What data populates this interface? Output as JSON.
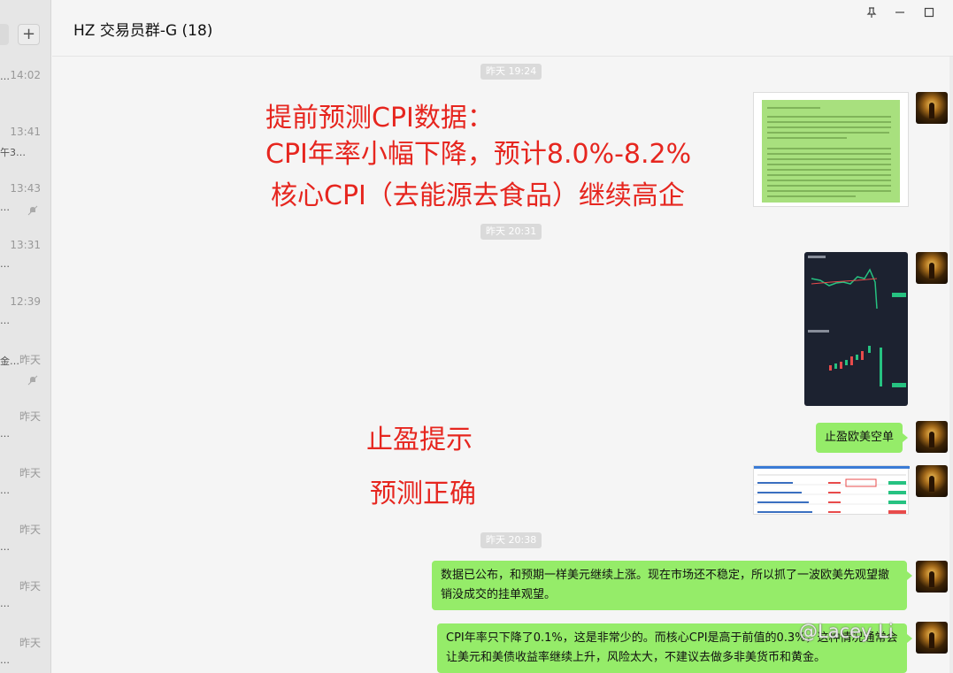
{
  "chat_list": {
    "plus_label": "+",
    "items": [
      {
        "time": "14:02",
        "snippet": "…"
      },
      {
        "time": "13:41",
        "snippet": "午3…"
      },
      {
        "time": "13:43",
        "snippet": "…"
      },
      {
        "time": "13:31",
        "snippet": "…"
      },
      {
        "time": "12:39",
        "snippet": "…"
      },
      {
        "time": "昨天",
        "snippet": "金…"
      },
      {
        "time": "昨天",
        "snippet": "…"
      },
      {
        "time": "昨天",
        "snippet": "…"
      },
      {
        "time": "昨天",
        "snippet": "…"
      },
      {
        "time": "昨天",
        "snippet": "…"
      },
      {
        "time": "昨天",
        "snippet": "…"
      }
    ]
  },
  "window": {
    "title": "HZ 交易员群-G (18)",
    "pin_icon": "pin-icon",
    "minimize_icon": "minimize-icon",
    "maximize_icon": "maximize-icon"
  },
  "messages": {
    "stamp1": "昨天 19:24",
    "stamp2": "昨天 20:31",
    "stamp3": "昨天 20:38",
    "bubble_take_profit": "止盈欧美空单",
    "bubble_data": "数据已公布，和预期一样美元继续上涨。现在市场还不稳定，所以抓了一波欧美先观望撤销没成交的挂单观望。",
    "bubble_cpi": "CPI年率只下降了0.1%，这是非常少的。而核心CPI是高于前值的0.3%，这种情况通常会让美元和美债收益率继续上升，风险太大，不建议去做多非美货币和黄金。"
  },
  "annotations": {
    "line1": "提前预测CPI数据：",
    "line2": "CPI年率小幅下降，预计8.0%-8.2%",
    "line3": "核心CPI（去能源去食品）继续高企",
    "take_profit": "止盈提示",
    "correct": "预测正确"
  },
  "watermark": "@Lacey Li",
  "colors": {
    "bubble": "#95ec69",
    "annotation": "#e6261f",
    "window_bg": "#f5f5f5"
  }
}
